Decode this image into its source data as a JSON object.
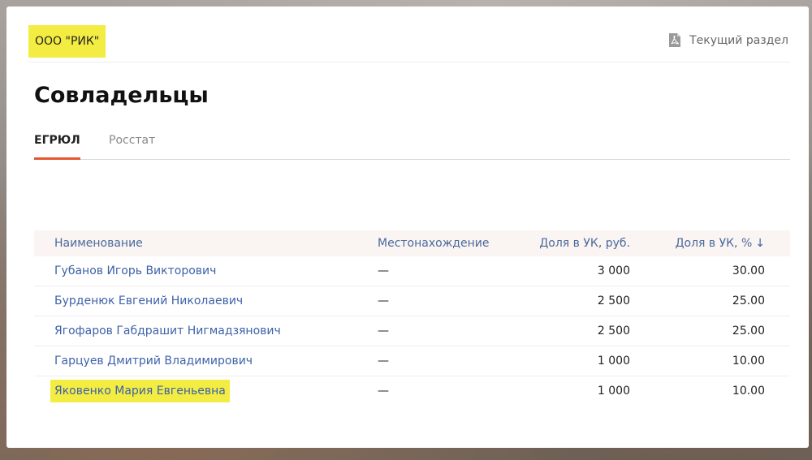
{
  "header": {
    "company_name": "ООО \"РИК\"",
    "section_link_label": "Текущий раздел",
    "section_link_icon": "pdf-icon"
  },
  "page": {
    "title": "Совладельцы"
  },
  "tabs": [
    {
      "label": "ЕГРЮЛ",
      "active": true
    },
    {
      "label": "Росстат",
      "active": false
    }
  ],
  "table": {
    "columns": {
      "name": "Наименование",
      "location": "Местонахождение",
      "share_rub": "Доля в УК, руб.",
      "share_pct": "Доля в УК, %"
    },
    "sort_indicator": "↓",
    "rows": [
      {
        "name": "Губанов Игорь Викторович",
        "location": "—",
        "share_rub": "3 000",
        "share_pct": "30.00"
      },
      {
        "name": "Бурденюк Евгений Николаевич",
        "location": "—",
        "share_rub": "2 500",
        "share_pct": "25.00"
      },
      {
        "name": "Ягофаров Габдрашит Нигмадзянович",
        "location": "—",
        "share_rub": "2 500",
        "share_pct": "25.00"
      },
      {
        "name": "Гарцуев Дмитрий Владимирович",
        "location": "—",
        "share_rub": "1 000",
        "share_pct": "10.00"
      },
      {
        "name": "Яковенко Мария Евгеньевна",
        "location": "—",
        "share_rub": "1 000",
        "share_pct": "10.00",
        "highlighted": true
      }
    ]
  },
  "colors": {
    "highlight": "#f3ec42",
    "link": "#3d62a8",
    "tab_accent": "#e4572e",
    "header_row_bg": "#faf4f2"
  }
}
